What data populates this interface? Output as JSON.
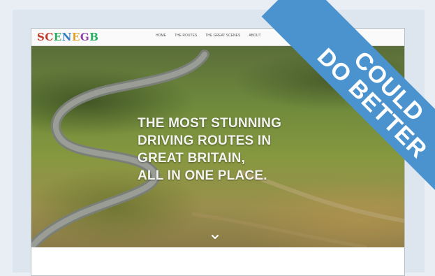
{
  "site": {
    "logo_letters": [
      "S",
      "C",
      "E",
      "N",
      "E",
      "G",
      "B"
    ],
    "logo_colors": [
      "#c0392b",
      "#c0392b",
      "#27ae60",
      "#2f7fc1",
      "#e1a22b",
      "#8e44ad",
      "#27ae60"
    ],
    "nav_items": [
      "Home",
      "The Routes",
      "The Great Scenes",
      "About"
    ],
    "hero": {
      "headline_lines": [
        "THE MOST STUNNING",
        "DRIVING ROUTES IN",
        "GREAT BRITAIN,",
        "ALL IN ONE PLACE."
      ],
      "scroll_icon": "chevron-down-icon"
    }
  },
  "ribbon": {
    "line1": "COULD",
    "line2": "DO BETTER",
    "color": "#4b93cf"
  }
}
